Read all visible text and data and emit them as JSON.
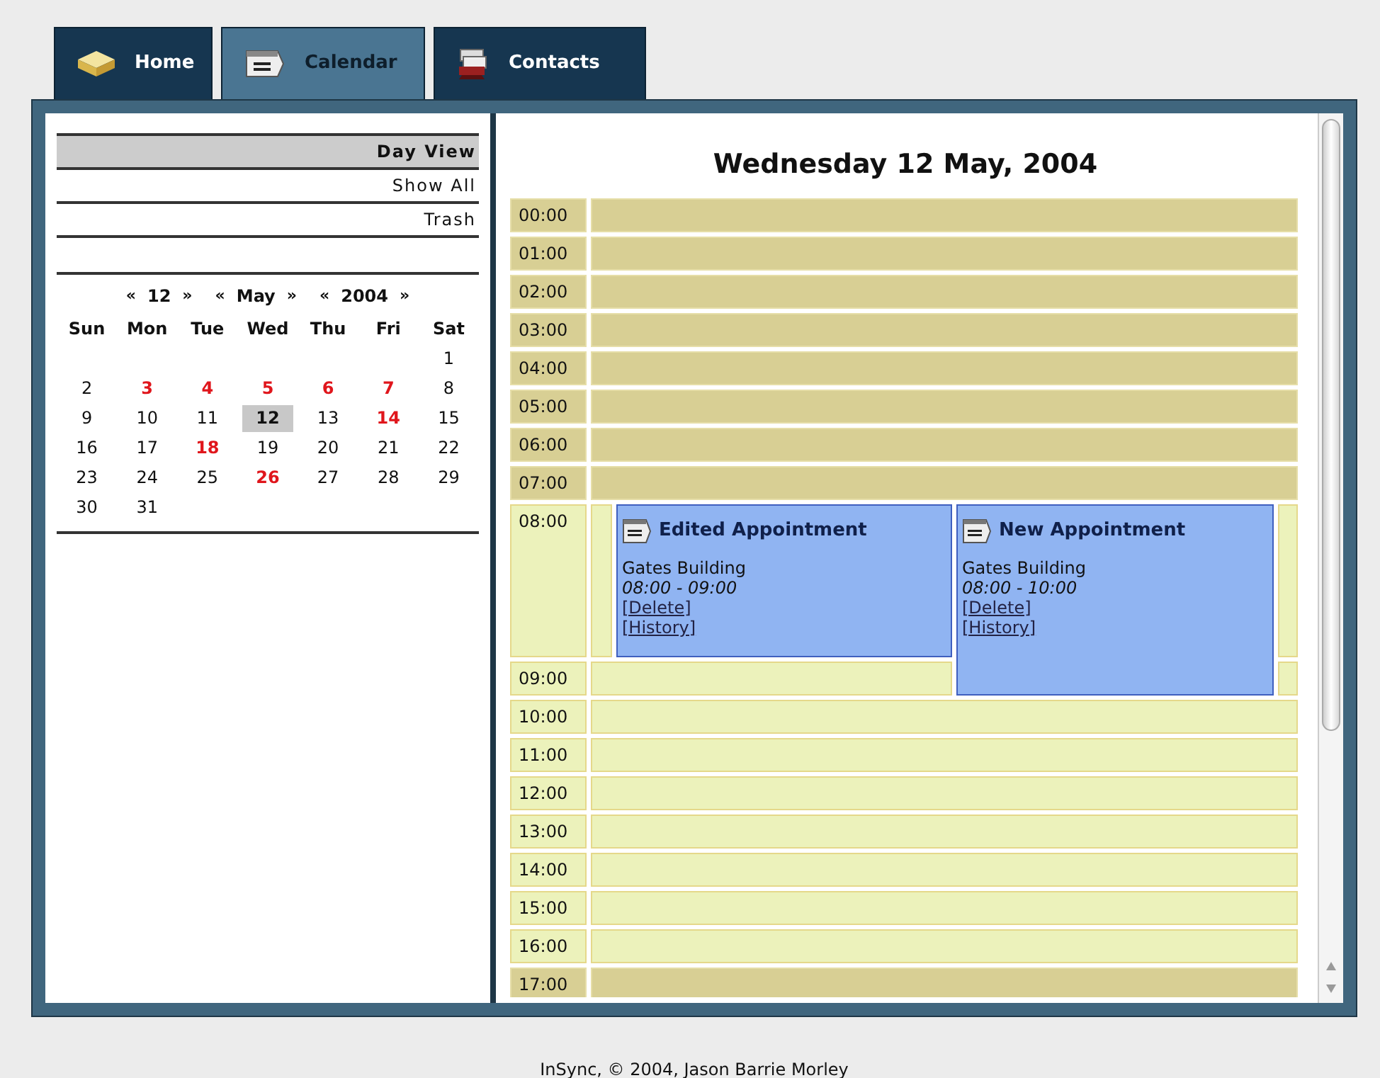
{
  "tabs": [
    {
      "label": "Home",
      "selected": false
    },
    {
      "label": "Calendar",
      "selected": true
    },
    {
      "label": "Contacts",
      "selected": false
    }
  ],
  "menu": [
    {
      "label": "Day View",
      "selected": true
    },
    {
      "label": "Show All",
      "selected": false
    },
    {
      "label": "Trash",
      "selected": false
    }
  ],
  "mini_calendar": {
    "nav": [
      {
        "prev": "«",
        "value": "12",
        "next": "»"
      },
      {
        "prev": "«",
        "value": "May",
        "next": "»"
      },
      {
        "prev": "«",
        "value": "2004",
        "next": "»"
      }
    ],
    "weekdays": [
      "Sun",
      "Mon",
      "Tue",
      "Wed",
      "Thu",
      "Fri",
      "Sat"
    ],
    "days": [
      {
        "day": "1",
        "has_events": false,
        "selected": false
      },
      {
        "day": "2",
        "has_events": false,
        "selected": false
      },
      {
        "day": "3",
        "has_events": true,
        "selected": false
      },
      {
        "day": "4",
        "has_events": true,
        "selected": false
      },
      {
        "day": "5",
        "has_events": true,
        "selected": false
      },
      {
        "day": "6",
        "has_events": true,
        "selected": false
      },
      {
        "day": "7",
        "has_events": true,
        "selected": false
      },
      {
        "day": "8",
        "has_events": false,
        "selected": false
      },
      {
        "day": "9",
        "has_events": false,
        "selected": false
      },
      {
        "day": "10",
        "has_events": false,
        "selected": false
      },
      {
        "day": "11",
        "has_events": false,
        "selected": false
      },
      {
        "day": "12",
        "has_events": false,
        "selected": true
      },
      {
        "day": "13",
        "has_events": false,
        "selected": false
      },
      {
        "day": "14",
        "has_events": true,
        "selected": false
      },
      {
        "day": "15",
        "has_events": false,
        "selected": false
      },
      {
        "day": "16",
        "has_events": false,
        "selected": false
      },
      {
        "day": "17",
        "has_events": false,
        "selected": false
      },
      {
        "day": "18",
        "has_events": true,
        "selected": false
      },
      {
        "day": "19",
        "has_events": false,
        "selected": false
      },
      {
        "day": "20",
        "has_events": false,
        "selected": false
      },
      {
        "day": "21",
        "has_events": false,
        "selected": false
      },
      {
        "day": "22",
        "has_events": false,
        "selected": false
      },
      {
        "day": "23",
        "has_events": false,
        "selected": false
      },
      {
        "day": "24",
        "has_events": false,
        "selected": false
      },
      {
        "day": "25",
        "has_events": false,
        "selected": false
      },
      {
        "day": "26",
        "has_events": true,
        "selected": false
      },
      {
        "day": "27",
        "has_events": false,
        "selected": false
      },
      {
        "day": "28",
        "has_events": false,
        "selected": false
      },
      {
        "day": "29",
        "has_events": false,
        "selected": false
      },
      {
        "day": "30",
        "has_events": false,
        "selected": false
      },
      {
        "day": "31",
        "has_events": false,
        "selected": false
      }
    ]
  },
  "day_title": "Wednesday 12 May, 2004",
  "hours": [
    {
      "label": "00:00",
      "off_hours": true
    },
    {
      "label": "01:00",
      "off_hours": true
    },
    {
      "label": "02:00",
      "off_hours": true
    },
    {
      "label": "03:00",
      "off_hours": true
    },
    {
      "label": "04:00",
      "off_hours": true
    },
    {
      "label": "05:00",
      "off_hours": true
    },
    {
      "label": "06:00",
      "off_hours": true
    },
    {
      "label": "07:00",
      "off_hours": true
    },
    {
      "label": "08:00",
      "off_hours": false
    },
    {
      "label": "09:00",
      "off_hours": false
    },
    {
      "label": "10:00",
      "off_hours": false
    },
    {
      "label": "11:00",
      "off_hours": false
    },
    {
      "label": "12:00",
      "off_hours": false
    },
    {
      "label": "13:00",
      "off_hours": false
    },
    {
      "label": "14:00",
      "off_hours": false
    },
    {
      "label": "15:00",
      "off_hours": false
    },
    {
      "label": "16:00",
      "off_hours": false
    },
    {
      "label": "17:00",
      "off_hours": true
    }
  ],
  "appointments": [
    {
      "title": "Edited Appointment",
      "location": "Gates Building",
      "time": "08:00 - 09:00",
      "links": [
        "[Delete]",
        "[History]"
      ]
    },
    {
      "title": "New Appointment",
      "location": "Gates Building",
      "time": "08:00 - 10:00",
      "links": [
        "[Delete]",
        "[History]"
      ]
    }
  ],
  "footer": "InSync, © 2004, Jason Barrie Morley"
}
